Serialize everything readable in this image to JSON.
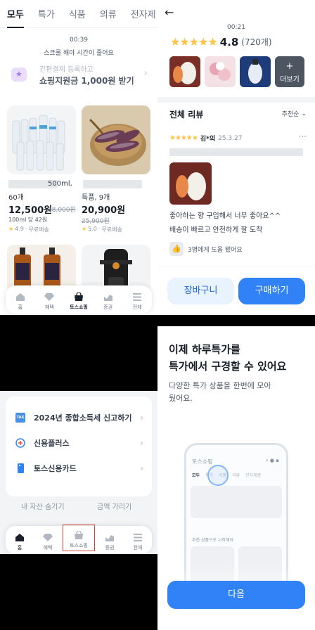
{
  "shop": {
    "tabs": [
      "모두",
      "특가",
      "식품",
      "의류",
      "전자제"
    ],
    "timer": "00:39",
    "timer_hint": "스크롤 해야 시간이 줄어요",
    "promo_line1": "간편결제 등록하고",
    "promo_line2": "쇼핑지원금 1,000원 받기",
    "products": [
      {
        "title_suffix": "500ml,",
        "title_line2": "60개",
        "price": "12,500원",
        "orig_price": "18,000원",
        "unit": "100ml 당 42원",
        "rating": "4.9",
        "shipping": "무료배송"
      },
      {
        "title_line2": "특품, 9개",
        "price": "20,900원",
        "orig_price": "25,900원",
        "rating": "5.0",
        "shipping": "무료배송"
      }
    ],
    "nav": [
      "홈",
      "혜택",
      "토스쇼핑",
      "증권",
      "전체"
    ],
    "nav_active": 2
  },
  "review": {
    "timer": "00:21",
    "rating": "4.8",
    "rating_count": "(720개)",
    "more_label": "더보기",
    "section_title": "전체 리뷰",
    "sort_label": "추천순",
    "reviewer": "김*의",
    "review_date": "25.3.27",
    "review_text_1": "좋아하는 향 구입해서 너무 좋아요^^",
    "review_text_2": "배송이 빠르고 안전하게 잘 도착",
    "helpful": "3명에게 도움 됐어요",
    "cart_label": "장바구니",
    "buy_label": "구매하기"
  },
  "assets": {
    "items": [
      "2024년 종합소득세 신고하기",
      "신용플러스",
      "토스신용카드"
    ],
    "tax_badge": "TAX",
    "hide_assets": "내 자산 숨기기",
    "hide_amount": "금액 가리기",
    "nav": [
      "홈",
      "혜택",
      "토스쇼핑",
      "증권",
      "전체"
    ],
    "nav_active": 2,
    "highlight_color": "#d0453a"
  },
  "onboarding": {
    "title_line1": "이제 하루특가를",
    "title_line2": "특가에서 구경할 수 있어요",
    "subtitle_line1": "다양한 특가 상품을 한번에 모아",
    "subtitle_line2": "뒀어요.",
    "mock_title": "토스쇼핑",
    "mock_tabs": [
      "모두",
      "특가",
      "식품",
      "의류",
      "전자제품"
    ],
    "mock_section": "추천 상품으로 시작해요",
    "next_label": "다음",
    "accent_color": "#3182f6"
  }
}
